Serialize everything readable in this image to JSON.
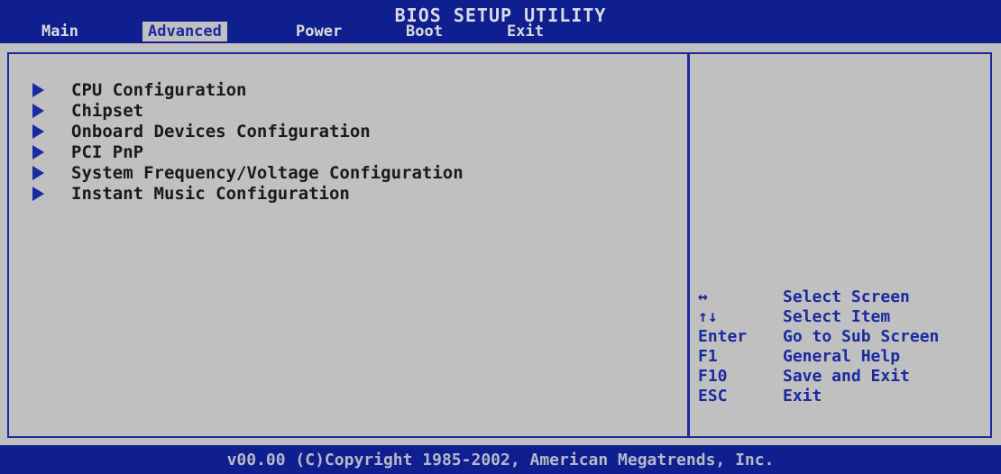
{
  "header": {
    "title": "BIOS SETUP UTILITY",
    "tabs": [
      {
        "label": "Main"
      },
      {
        "label": "Advanced"
      },
      {
        "label": "Power"
      },
      {
        "label": "Boot"
      },
      {
        "label": "Exit"
      }
    ],
    "active_tab": "Advanced"
  },
  "menu": {
    "items": [
      {
        "label": "CPU Configuration"
      },
      {
        "label": "Chipset"
      },
      {
        "label": "Onboard Devices Configuration"
      },
      {
        "label": "PCI PnP"
      },
      {
        "label": "System Frequency/Voltage Configuration"
      },
      {
        "label": "Instant Music Configuration"
      }
    ]
  },
  "help": {
    "rows": [
      {
        "key": "↔",
        "desc": "Select Screen"
      },
      {
        "key": "↑↓",
        "desc": "Select Item"
      },
      {
        "key": "Enter",
        "desc": "Go to Sub Screen"
      },
      {
        "key": "F1",
        "desc": "General Help"
      },
      {
        "key": "F10",
        "desc": "Save and Exit"
      },
      {
        "key": "ESC",
        "desc": "Exit"
      }
    ]
  },
  "footer": {
    "copyright": "v00.00 (C)Copyright 1985-2002, American Megatrends, Inc."
  },
  "colors": {
    "bar_blue": "#0f1f8f",
    "panel_gray": "#c0c0c0",
    "accent_blue": "#1a2aa0"
  }
}
